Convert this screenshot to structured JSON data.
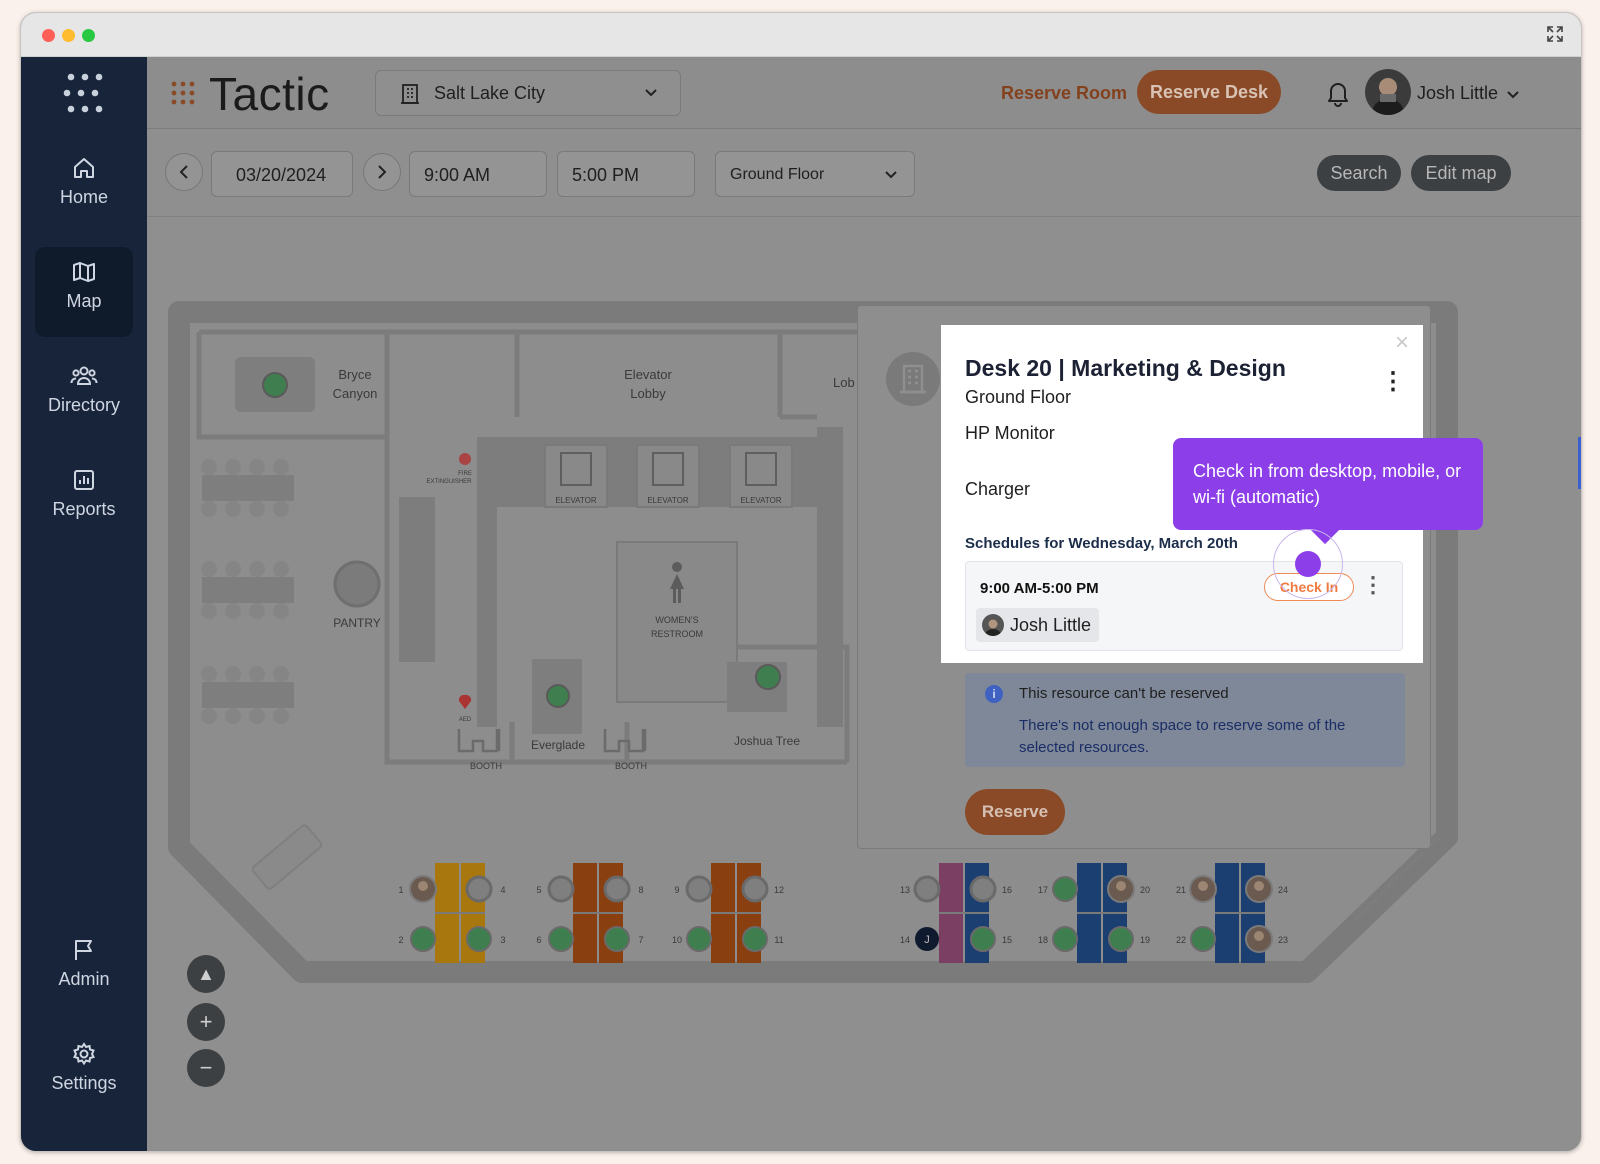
{
  "app": {
    "name": "Tactic",
    "accent": "#f08a55",
    "brand_purple": "#8c3ee9",
    "sidebar_bg": "#17243a"
  },
  "sidebar": {
    "items": [
      {
        "label": "Home",
        "icon": "home-icon",
        "active": false
      },
      {
        "label": "Map",
        "icon": "map-icon",
        "active": true
      },
      {
        "label": "Directory",
        "icon": "people-icon",
        "active": false
      },
      {
        "label": "Reports",
        "icon": "chart-icon",
        "active": false
      },
      {
        "label": "Admin",
        "icon": "flag-icon",
        "active": false
      },
      {
        "label": "Settings",
        "icon": "gear-icon",
        "active": false
      }
    ]
  },
  "header": {
    "location": "Salt Lake City",
    "reserve_room": "Reserve Room",
    "reserve_desk": "Reserve Desk",
    "user_name": "Josh Little"
  },
  "toolbar": {
    "prev": "<",
    "next": ">",
    "date": "03/20/2024",
    "start_time": "9:00 AM",
    "end_time": "5:00 PM",
    "floor": "Ground Floor",
    "search": "Search",
    "edit_map": "Edit map"
  },
  "map": {
    "rooms": [
      "Bryce",
      "Canyon",
      "Elevator",
      "Lobby",
      "Lob",
      "PANTRY",
      "Everglade",
      "Joshua Tree",
      "WOMEN'S",
      "RESTROOM"
    ],
    "elevator_label": "ELEVATOR",
    "booth_label": "BOOTH",
    "fire_label": "FIRE",
    "extinguisher_label": "EXTINGUISHER",
    "aed_label": "AED",
    "desk_numbers": [
      "1",
      "2",
      "3",
      "4",
      "5",
      "6",
      "7",
      "8",
      "9",
      "10",
      "11",
      "12",
      "13",
      "14",
      "15",
      "16",
      "17",
      "18",
      "19",
      "20",
      "21",
      "22",
      "23",
      "24"
    ],
    "avatar_initial": "J",
    "controls": {
      "compass": "▲",
      "zoom_in": "+",
      "zoom_out": "−"
    }
  },
  "desk_card": {
    "title": "Desk 20 | Marketing & Design",
    "floor": "Ground Floor",
    "amenities": [
      "HP Monitor",
      "Charger"
    ],
    "schedule_heading": "Schedules for Wednesday, March 20th",
    "schedule_time": "9:00 AM-5:00 PM",
    "check_in": "Check In",
    "person": "Josh Little",
    "close": "×",
    "menu": "⋮"
  },
  "tooltip": {
    "text": "Check in from desktop, mobile, or wi-fi (automatic)"
  },
  "notice": {
    "title": "This resource can't be reserved",
    "body": "There's not enough space to reserve some of the selected resources.",
    "info": "i"
  },
  "reserve_button": "Reserve"
}
